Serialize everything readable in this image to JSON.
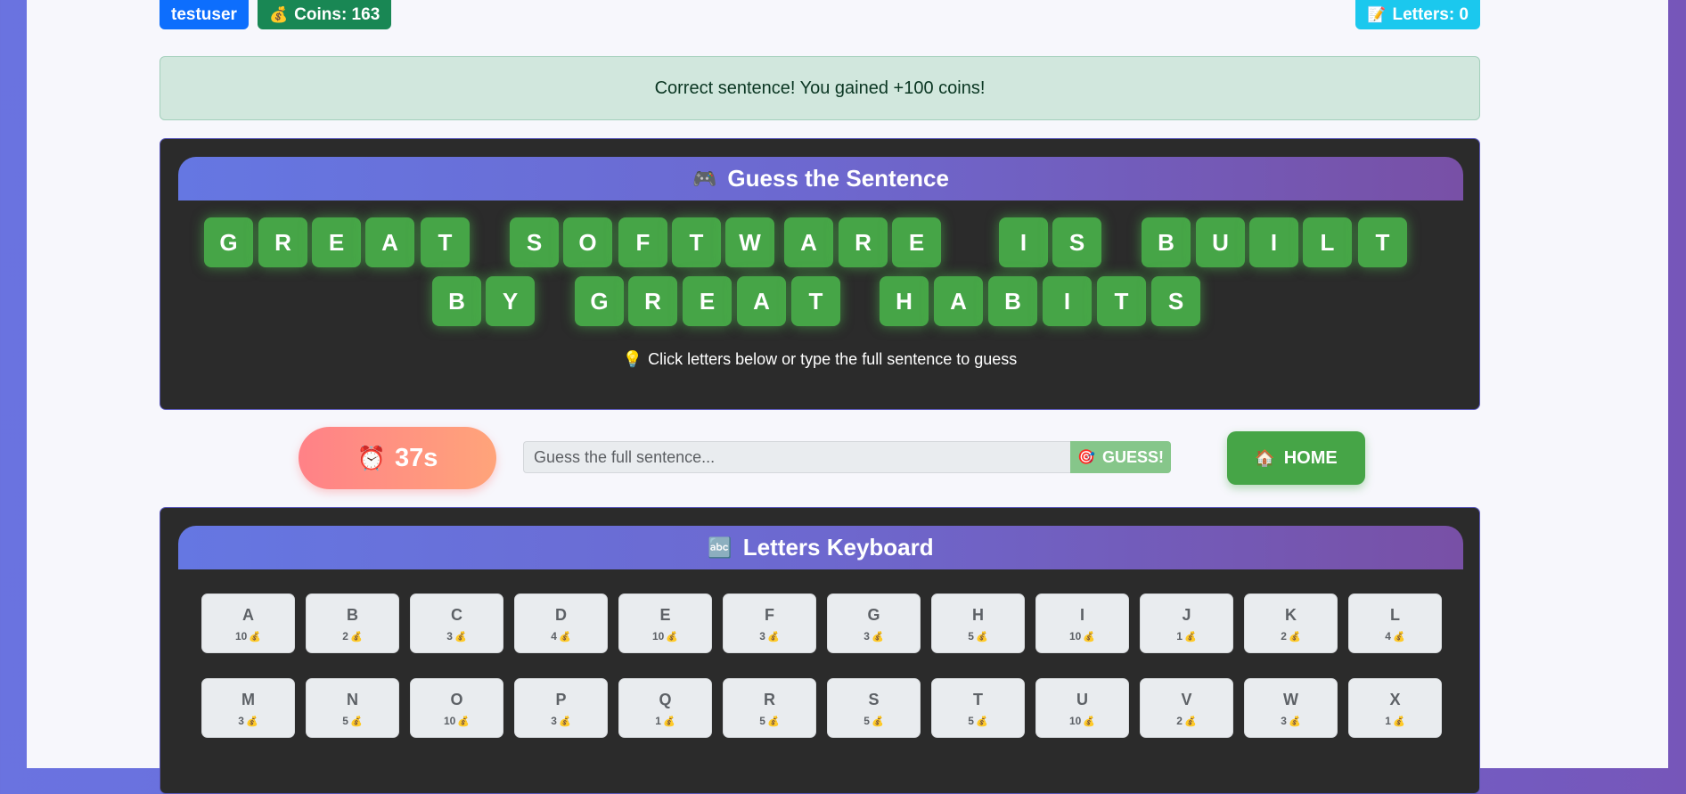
{
  "user": {
    "name": "testuser"
  },
  "coins": {
    "icon": "money-bag-icon",
    "label": "Coins: 163"
  },
  "letters_badge": {
    "icon": "memo-icon",
    "label": "Letters: 0"
  },
  "alert": {
    "message": "Correct sentence! You gained +100 coins!"
  },
  "guess_panel": {
    "title": "Guess the Sentence",
    "title_icon": "game-controller-icon",
    "rows": [
      [
        "G",
        "R",
        "E",
        "A",
        "T",
        "S",
        "O",
        "F",
        "T",
        "W",
        "A",
        "R",
        "E",
        "I",
        "S",
        "B",
        "U",
        "I",
        "L",
        "T"
      ],
      [
        "B",
        "Y",
        "G",
        "R",
        "E",
        "A",
        "T",
        "H",
        "A",
        "B",
        "I",
        "T",
        "S"
      ]
    ],
    "hint_icon": "light-bulb-icon",
    "hint": "Click letters below or type the full sentence to guess"
  },
  "timer": {
    "icon": "alarm-clock-icon",
    "value": "37s"
  },
  "guess_form": {
    "placeholder": "Guess the full sentence...",
    "button_icon": "target-icon",
    "button_label": "GUESS!"
  },
  "home": {
    "icon": "house-icon",
    "label": "HOME"
  },
  "keyboard": {
    "title": "Letters Keyboard",
    "title_icon": "abc-icon",
    "coin_icon": "money-bag-icon",
    "keys": [
      {
        "letter": "A",
        "cost": "10"
      },
      {
        "letter": "B",
        "cost": "2"
      },
      {
        "letter": "C",
        "cost": "3"
      },
      {
        "letter": "D",
        "cost": "4"
      },
      {
        "letter": "E",
        "cost": "10"
      },
      {
        "letter": "F",
        "cost": "3"
      },
      {
        "letter": "G",
        "cost": "3"
      },
      {
        "letter": "H",
        "cost": "5"
      },
      {
        "letter": "I",
        "cost": "10"
      },
      {
        "letter": "J",
        "cost": "1"
      },
      {
        "letter": "K",
        "cost": "2"
      },
      {
        "letter": "L",
        "cost": "4"
      },
      {
        "letter": "M",
        "cost": "3"
      },
      {
        "letter": "N",
        "cost": "5"
      },
      {
        "letter": "O",
        "cost": "10"
      },
      {
        "letter": "P",
        "cost": "3"
      },
      {
        "letter": "Q",
        "cost": "1"
      },
      {
        "letter": "R",
        "cost": "5"
      },
      {
        "letter": "S",
        "cost": "5"
      },
      {
        "letter": "T",
        "cost": "5"
      },
      {
        "letter": "U",
        "cost": "10"
      },
      {
        "letter": "V",
        "cost": "2"
      },
      {
        "letter": "W",
        "cost": "3"
      },
      {
        "letter": "X",
        "cost": "1"
      }
    ]
  },
  "colors": {
    "tile_green": "#46a547",
    "header_gradient_start": "#6577e2",
    "header_gradient_end": "#7850a6",
    "panel_bg": "#2b2b2b",
    "alert_bg": "#d1e7dd"
  }
}
